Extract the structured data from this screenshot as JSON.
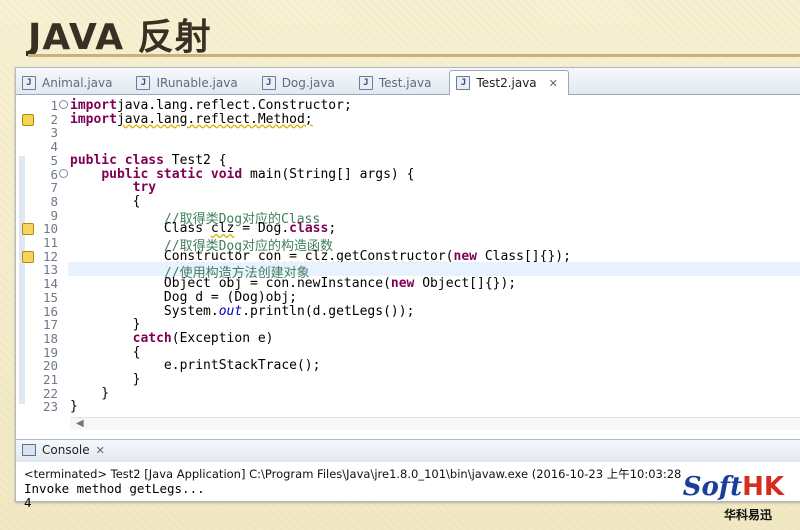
{
  "slide": {
    "title": "JAVA 反射",
    "accent_color": "#c8b27a"
  },
  "tabs": [
    {
      "label": "Animal.java",
      "active": false
    },
    {
      "label": "IRunable.java",
      "active": false
    },
    {
      "label": "Dog.java",
      "active": false
    },
    {
      "label": "Test.java",
      "active": false
    },
    {
      "label": "Test2.java",
      "active": true
    }
  ],
  "editor": {
    "lines": [
      {
        "num": "1",
        "tokens": [
          [
            "kw",
            "import"
          ],
          [
            "",
            "java.lang.reflect.Constructor;"
          ]
        ]
      },
      {
        "num": "2",
        "tokens": [
          [
            "kw",
            "import"
          ],
          [
            "warn",
            "java.lang.reflect.Method;"
          ]
        ]
      },
      {
        "num": "3",
        "tokens": []
      },
      {
        "num": "4",
        "tokens": []
      },
      {
        "num": "5",
        "tokens": [
          [
            "kw",
            "public class"
          ],
          [
            "",
            " Test2 {"
          ]
        ]
      },
      {
        "num": "6",
        "tokens": [
          [
            "",
            "    "
          ],
          [
            "kw",
            "public static void"
          ],
          [
            "",
            " main(String[] args) {"
          ]
        ]
      },
      {
        "num": "7",
        "tokens": [
          [
            "",
            "        "
          ],
          [
            "kw",
            "try"
          ]
        ]
      },
      {
        "num": "8",
        "tokens": [
          [
            "",
            "        {"
          ]
        ]
      },
      {
        "num": "9",
        "tokens": [
          [
            "",
            "            "
          ],
          [
            "cm",
            "//取得类Dog对应的Class"
          ]
        ]
      },
      {
        "num": "10",
        "tokens": [
          [
            "",
            "            Class "
          ],
          [
            "warn",
            "clz"
          ],
          [
            "",
            " = Dog."
          ],
          [
            "kw",
            "class"
          ],
          [
            "",
            ";"
          ]
        ]
      },
      {
        "num": "11",
        "tokens": [
          [
            "",
            "            "
          ],
          [
            "cm",
            "//取得类Dog对应的构造函数"
          ]
        ]
      },
      {
        "num": "12",
        "tokens": [
          [
            "",
            "            Constructor "
          ],
          [
            "warn",
            "con = clz.getConstructor("
          ],
          [
            "kw",
            "new"
          ],
          [
            "",
            " Class[]{});"
          ]
        ]
      },
      {
        "num": "13",
        "tokens": [
          [
            "",
            "            "
          ],
          [
            "cm",
            "//使用构造方法创建对象"
          ]
        ]
      },
      {
        "num": "14",
        "tokens": [
          [
            "",
            "            Object obj = con.newInstance("
          ],
          [
            "kw",
            "new"
          ],
          [
            "",
            " Object[]{});"
          ]
        ]
      },
      {
        "num": "15",
        "tokens": [
          [
            "",
            "            Dog d = (Dog)obj;"
          ]
        ]
      },
      {
        "num": "16",
        "tokens": [
          [
            "",
            "            System."
          ],
          [
            "it",
            "out"
          ],
          [
            "",
            ".println(d.getLegs());"
          ]
        ]
      },
      {
        "num": "17",
        "tokens": [
          [
            "",
            "        }"
          ]
        ]
      },
      {
        "num": "18",
        "tokens": [
          [
            "",
            "        "
          ],
          [
            "kw",
            "catch"
          ],
          [
            "",
            "(Exception e)"
          ]
        ]
      },
      {
        "num": "19",
        "tokens": [
          [
            "",
            "        {"
          ]
        ]
      },
      {
        "num": "20",
        "tokens": [
          [
            "",
            "            e.printStackTrace();"
          ]
        ]
      },
      {
        "num": "21",
        "tokens": [
          [
            "",
            "        }"
          ]
        ]
      },
      {
        "num": "22",
        "tokens": [
          [
            "",
            "    }"
          ]
        ]
      },
      {
        "num": "23",
        "tokens": [
          [
            "",
            "}"
          ]
        ]
      }
    ]
  },
  "console": {
    "tab_label": "Console",
    "status": "<terminated> Test2 [Java Application] C:\\Program Files\\Java\\jre1.8.0_101\\bin\\javaw.exe (2016-10-23 上午10:03:28",
    "output": [
      "Invoke method getLegs...",
      "4"
    ]
  },
  "logo": {
    "main": "Soft",
    "hk": "HK",
    "sub": "华科易迅"
  }
}
